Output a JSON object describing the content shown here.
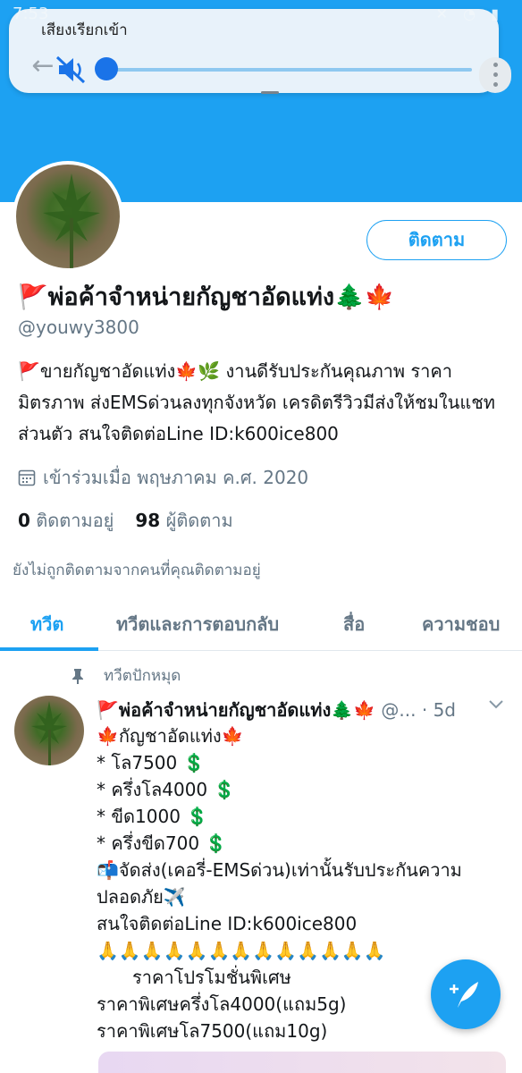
{
  "status_bar": {
    "time": "7:53"
  },
  "volume_panel": {
    "title": "เสียงเรียกเข้า",
    "level": 0
  },
  "profile": {
    "follow_label": "ติดตาม",
    "display_name": "🚩พ่อค้าจำหน่ายกัญชาอัดแท่ง🌲🍁",
    "handle": "@youwy3800",
    "bio": "🚩ขายกัญชาอัดแท่ง🍁🌿 งานดีรับประกันคุณภาพ ราคามิตรภาพ ส่งEMSด่วนลงทุกจังหวัด เครดิตรีวิวมีส่งให้ชมในแชทส่วนตัว สนใจติดต่อLine ID:k600ice800",
    "joined": "เข้าร่วมเมื่อ พฤษภาคม ค.ศ. 2020",
    "following_count": "0",
    "following_label": "ติดตามอยู่",
    "followers_count": "98",
    "followers_label": "ผู้ติดตาม",
    "not_followed_note": "ยังไม่ถูกติดตามจากคนที่คุณติดตามอยู่"
  },
  "tabs": [
    {
      "label": "ทวีต"
    },
    {
      "label": "ทวีตและการตอบกลับ"
    },
    {
      "label": "สื่อ"
    },
    {
      "label": "ความชอบ"
    }
  ],
  "tweet": {
    "pinned_label": "ทวีตปักหมุด",
    "author": "🚩พ่อค้าจำหน่ายกัญชาอัดแท่ง🌲🍁",
    "handle_truncated": "@...",
    "time": "· 5d",
    "lines": [
      "🍁กัญชาอัดแท่ง🍁",
      "* โล7500 💲",
      "* ครึ่งโล4000 💲",
      "* ขีด1000 💲",
      "* ครึ่งขีด700 💲",
      "📬จัดส่ง(เคอรี่-EMSด่วน)เท่านั้นรับประกันความ",
      "ปลอดภัย✈️",
      "สนใจติดต่อLine ID:k600ice800",
      "🙏🙏🙏🙏🙏🙏🙏🙏🙏🙏🙏🙏🙏",
      "ราคาโปรโมชั่นพิเศษ",
      "ราคาพิเศษครึ่งโล4000(แถม5g)",
      "ราคาพิเศษโล7500(แถม10g)"
    ]
  },
  "colors": {
    "accent": "#1da1f2",
    "muted": "#657786",
    "text": "#14171a"
  }
}
